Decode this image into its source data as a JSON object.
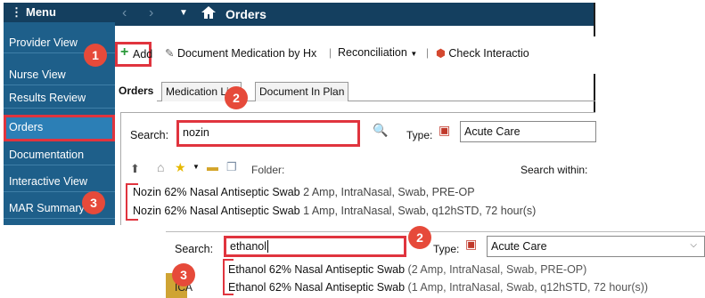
{
  "sidebar": {
    "header": "Menu",
    "items": [
      {
        "label": "Provider View"
      },
      {
        "label": "Nurse View"
      },
      {
        "label": "Results Review"
      },
      {
        "label": "Orders"
      },
      {
        "label": "Documentation"
      },
      {
        "label": "Interactive View"
      },
      {
        "label": "MAR Summary"
      }
    ]
  },
  "topbar": {
    "title": "Orders"
  },
  "toolbar": {
    "add_label": "Add",
    "doc_med_label": "Document Medication by Hx",
    "reconciliation_label": "Reconciliation",
    "check_label": "Check Interactio"
  },
  "tabs": [
    "Orders",
    "Medication List",
    "Document In Plan"
  ],
  "search": {
    "label": "Search:",
    "value": "nozin",
    "type_label": "Type:",
    "type_value": "Acute Care",
    "folder_label": "Folder:",
    "search_within_label": "Search within:"
  },
  "results": [
    {
      "name": "Nozin 62% Nasal Antiseptic Swab",
      "detail": "2 Amp, IntraNasal, Swab, PRE-OP"
    },
    {
      "name": "Nozin 62% Nasal Antiseptic Swab",
      "detail": "1 Amp, IntraNasal, Swab, q12hSTD, 72 hour(s)"
    }
  ],
  "lower": {
    "search_label": "Search:",
    "search_value": "ethanol",
    "type_label": "Type:",
    "type_value": "Acute Care",
    "partial_text": "ICA",
    "results": [
      {
        "name": "Ethanol 62% Nasal Antiseptic Swab",
        "detail": "(2 Amp, IntraNasal, Swab, PRE-OP)"
      },
      {
        "name": "Ethanol 62% Nasal Antiseptic Swab",
        "detail": "(1 Amp, IntraNasal, Swab, q12hSTD, 72 hour(s))"
      }
    ]
  },
  "badges": {
    "one": "1",
    "two": "2",
    "three": "3"
  },
  "colors": {
    "nav_dark": "#143f5f",
    "nav": "#1e5f8a",
    "highlight": "#e0343e",
    "badge": "#e64a3a"
  }
}
